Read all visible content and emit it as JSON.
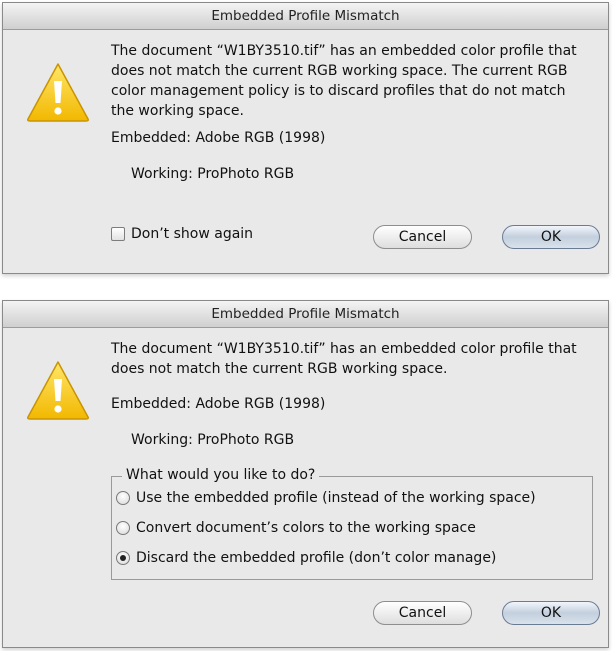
{
  "dialog1": {
    "title": "Embedded Profile Mismatch",
    "message": "The document “W1BY3510.tif” has an embedded color profile that does not match the current RGB working space.  The current RGB color management policy is to discard profiles that do not match the working space.",
    "embedded_label": "Embedded:",
    "embedded_value": "Adobe RGB (1998)",
    "working_label": "Working:",
    "working_value": "ProPhoto RGB",
    "checkbox_label": "Don’t show again",
    "checkbox_checked": false,
    "cancel_label": "Cancel",
    "ok_label": "OK"
  },
  "dialog2": {
    "title": "Embedded Profile Mismatch",
    "message": "The document “W1BY3510.tif” has an embedded color profile that does not match the current RGB working space.",
    "embedded_label": "Embedded:",
    "embedded_value": "Adobe RGB (1998)",
    "working_label": "Working:",
    "working_value": "ProPhoto RGB",
    "group_title": "What would you like to do?",
    "options": [
      {
        "label": "Use the embedded profile (instead of the working space)",
        "selected": false
      },
      {
        "label": "Convert document’s colors to the working space",
        "selected": false
      },
      {
        "label": "Discard the embedded profile (don’t color manage)",
        "selected": true
      }
    ],
    "cancel_label": "Cancel",
    "ok_label": "OK"
  },
  "icons": {
    "warning": "warning-triangle-icon"
  },
  "colors": {
    "dialog_bg": "#e9e9e9",
    "warning_yellow": "#f6c500",
    "default_button": "#c3cfdd"
  }
}
